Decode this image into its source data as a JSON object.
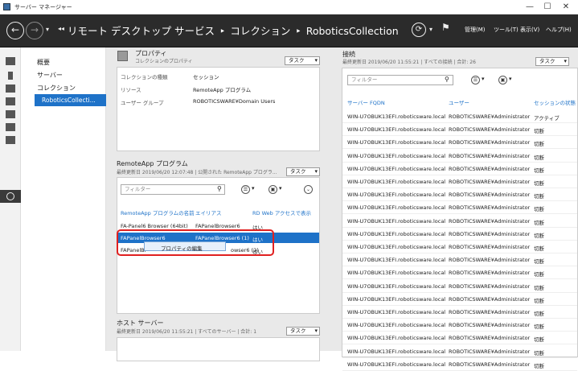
{
  "window": {
    "title": "サーバー マネージャー",
    "min": "—",
    "max": "☐",
    "close": "✕"
  },
  "breadcrumb": {
    "sep": "‣",
    "items": [
      "リモート デスクトップ サービス",
      "コレクション",
      "RoboticsCollection"
    ]
  },
  "menus": [
    "管理(M)",
    "ツール(T)",
    "表示(V)",
    "ヘルプ(H)"
  ],
  "icons": {
    "back": "←",
    "forward": "→",
    "dropdown": "▾",
    "prefix": "◂◂",
    "refresh": "⟳",
    "flag": "⚑"
  },
  "nav": {
    "items": [
      "概要",
      "サーバー",
      "コレクション"
    ],
    "selected": "RoboticsCollecti..."
  },
  "properties": {
    "title": "プロパティ",
    "subtitle": "コレクションのプロパティ",
    "task": "タスク",
    "rows": [
      [
        "コレクションの種類",
        "セッション"
      ],
      [
        "リソース",
        "RemoteApp プログラム"
      ],
      [
        "ユーザー グループ",
        "ROBOTICSWARE¥Domain Users"
      ]
    ]
  },
  "remoteapp": {
    "title": "RemoteApp プログラム",
    "subtitle": "最終更新日 2019/06/20 12:07:48 | 公開された RemoteApp プログラ...",
    "task": "タスク",
    "filter": "フィルター",
    "headers": [
      "RemoteApp プログラムの名前",
      "エイリアス",
      "RD Web アクセスで表示"
    ],
    "rows": [
      [
        "FA-Panel6 Browser (64bit)",
        "FAPanelBrowser6",
        "はい"
      ],
      [
        "FAPanelBrowser6",
        "FAPanelBrowser6 (1)",
        "はい"
      ],
      [
        "FAPanelBr",
        "owser6 (2)",
        "はい"
      ]
    ],
    "context_menu": "プロパティの編集"
  },
  "hostservers": {
    "title": "ホスト サーバー",
    "subtitle": "最終更新日 2019/06/20 11:55:21 | すべてのサーバー | 合計: 1",
    "task": "タスク"
  },
  "connections": {
    "title": "接続",
    "subtitle": "最終更新日 2019/06/20 11:55:21 | すべての接続 | 合計: 26",
    "task": "タスク",
    "filter": "フィルター",
    "headers": [
      "サーバー FQDN",
      "ユーザー",
      "セッションの状態"
    ],
    "rows": [
      [
        "WIN-U7OBUK13EFI.roboticsware.local",
        "ROBOTICSWARE¥Administrator",
        "アクティブ"
      ],
      [
        "WIN-U7OBUK13EFI.roboticsware.local",
        "ROBOTICSWARE¥Administrator",
        "切断"
      ],
      [
        "WIN-U7OBUK13EFI.roboticsware.local",
        "ROBOTICSWARE¥Administrator",
        "切断"
      ],
      [
        "WIN-U7OBUK13EFI.roboticsware.local",
        "ROBOTICSWARE¥Administrator",
        "切断"
      ],
      [
        "WIN-U7OBUK13EFI.roboticsware.local",
        "ROBOTICSWARE¥Administrator",
        "切断"
      ],
      [
        "WIN-U7OBUK13EFI.roboticsware.local",
        "ROBOTICSWARE¥Administrator",
        "切断"
      ],
      [
        "WIN-U7OBUK13EFI.roboticsware.local",
        "ROBOTICSWARE¥Administrator",
        "切断"
      ],
      [
        "WIN-U7OBUK13EFI.roboticsware.local",
        "ROBOTICSWARE¥Administrator",
        "切断"
      ],
      [
        "WIN-U7OBUK13EFI.roboticsware.local",
        "ROBOTICSWARE¥Administrator",
        "切断"
      ],
      [
        "WIN-U7OBUK13EFI.roboticsware.local",
        "ROBOTICSWARE¥Administrator",
        "切断"
      ],
      [
        "WIN-U7OBUK13EFI.roboticsware.local",
        "ROBOTICSWARE¥Administrator",
        "切断"
      ],
      [
        "WIN-U7OBUK13EFI.roboticsware.local",
        "ROBOTICSWARE¥Administrator",
        "切断"
      ],
      [
        "WIN-U7OBUK13EFI.roboticsware.local",
        "ROBOTICSWARE¥Administrator",
        "切断"
      ],
      [
        "WIN-U7OBUK13EFI.roboticsware.local",
        "ROBOTICSWARE¥Administrator",
        "切断"
      ],
      [
        "WIN-U7OBUK13EFI.roboticsware.local",
        "ROBOTICSWARE¥Administrator",
        "切断"
      ],
      [
        "WIN-U7OBUK13EFI.roboticsware.local",
        "ROBOTICSWARE¥Administrator",
        "切断"
      ],
      [
        "WIN-U7OBUK13EFI.roboticsware.local",
        "ROBOTICSWARE¥Administrator",
        "切断"
      ],
      [
        "WIN-U7OBUK13EFI.roboticsware.local",
        "ROBOTICSWARE¥Administrator",
        "切断"
      ],
      [
        "WIN-U7OBUK13EFI.roboticsware.local",
        "ROBOTICSWARE¥Administrator",
        "切断"
      ],
      [
        "WIN-U7OBUK13EFI.roboticsware.local",
        "ROBOTICSWARE¥Administrator",
        "切断"
      ]
    ]
  }
}
